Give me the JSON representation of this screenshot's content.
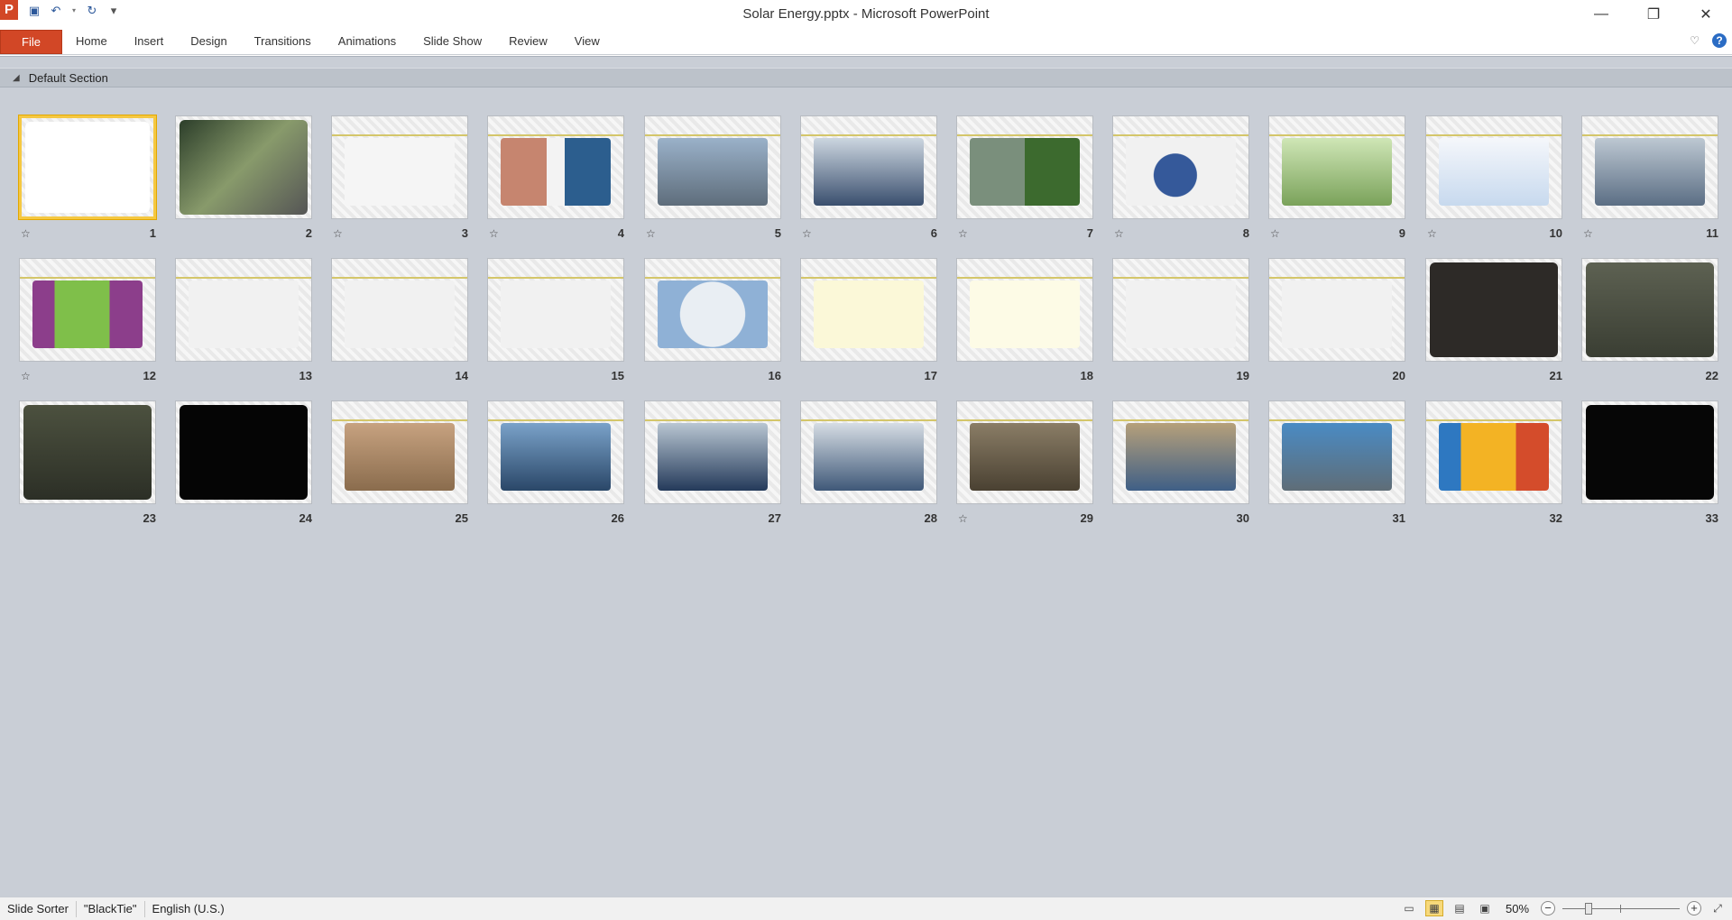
{
  "window": {
    "title": "Solar Energy.pptx  -  Microsoft PowerPoint",
    "app_icon_letter": "P"
  },
  "ribbon": {
    "file_label": "File",
    "tabs": [
      "Home",
      "Insert",
      "Design",
      "Transitions",
      "Animations",
      "Slide Show",
      "Review",
      "View"
    ]
  },
  "section": {
    "name": "Default Section"
  },
  "slides": [
    {
      "num": "1",
      "trans": true
    },
    {
      "num": "2",
      "trans": false
    },
    {
      "num": "3",
      "trans": true
    },
    {
      "num": "4",
      "trans": true
    },
    {
      "num": "5",
      "trans": true
    },
    {
      "num": "6",
      "trans": true
    },
    {
      "num": "7",
      "trans": true
    },
    {
      "num": "8",
      "trans": true
    },
    {
      "num": "9",
      "trans": true
    },
    {
      "num": "10",
      "trans": true
    },
    {
      "num": "11",
      "trans": true
    },
    {
      "num": "12",
      "trans": true
    },
    {
      "num": "13",
      "trans": false
    },
    {
      "num": "14",
      "trans": false
    },
    {
      "num": "15",
      "trans": false
    },
    {
      "num": "16",
      "trans": false
    },
    {
      "num": "17",
      "trans": false
    },
    {
      "num": "18",
      "trans": false
    },
    {
      "num": "19",
      "trans": false
    },
    {
      "num": "20",
      "trans": false
    },
    {
      "num": "21",
      "trans": false
    },
    {
      "num": "22",
      "trans": false
    },
    {
      "num": "23",
      "trans": false
    },
    {
      "num": "24",
      "trans": false
    },
    {
      "num": "25",
      "trans": false
    },
    {
      "num": "26",
      "trans": false
    },
    {
      "num": "27",
      "trans": false
    },
    {
      "num": "28",
      "trans": false
    },
    {
      "num": "29",
      "trans": true
    },
    {
      "num": "30",
      "trans": false
    },
    {
      "num": "31",
      "trans": false
    },
    {
      "num": "32",
      "trans": false
    },
    {
      "num": "33",
      "trans": false
    }
  ],
  "statusbar": {
    "view": "Slide Sorter",
    "theme": "\"BlackTie\"",
    "language": "English (U.S.)",
    "zoom": "50%",
    "zoom_level": 0.5
  }
}
